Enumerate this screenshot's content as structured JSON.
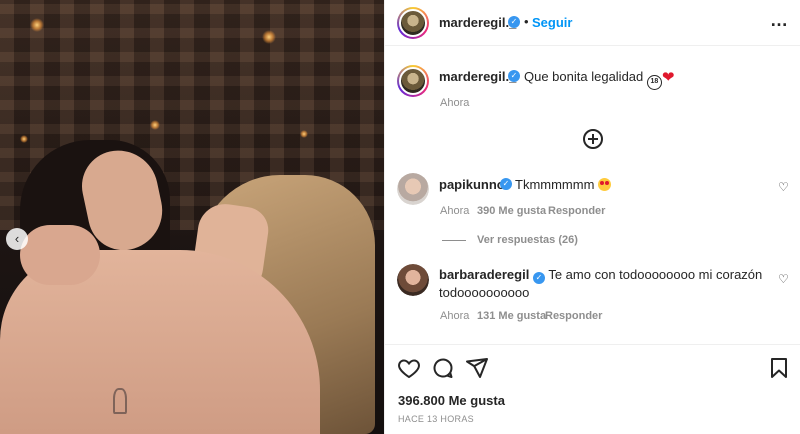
{
  "post_author": {
    "username": "marderegil._",
    "verified": true,
    "follow_label": "Seguir",
    "more_icon": "more-options-icon"
  },
  "caption": {
    "username": "marderegil._",
    "text": "Que bonita legalidad",
    "emoji_18": "18",
    "time": "Ahora"
  },
  "load_more_icon": "plus-circle-icon",
  "comments": [
    {
      "username": "papikunno",
      "verified": true,
      "text": "Tkmmmmmm",
      "time": "Ahora",
      "likes": "390 Me gusta",
      "reply_label": "Responder",
      "view_replies": "Ver respuestas (26)"
    },
    {
      "username": "barbaraderegil",
      "verified": true,
      "text_line1": "Te amo con todoooooooo mi corazón",
      "text_line2": "todoooooooooo",
      "time": "Ahora",
      "likes": "131 Me gusta",
      "reply_label": "Responder"
    }
  ],
  "actions": {
    "icons": [
      "heart-icon",
      "comment-icon",
      "share-icon",
      "bookmark-icon"
    ],
    "likes_count": "396.800 Me gusta",
    "posted_time": "HACE 13 HORAS"
  },
  "colors": {
    "link_blue": "#0095f6",
    "verified_blue": "#3897f0",
    "muted_text": "#8e8e8e",
    "heart_red": "#e0182d"
  }
}
